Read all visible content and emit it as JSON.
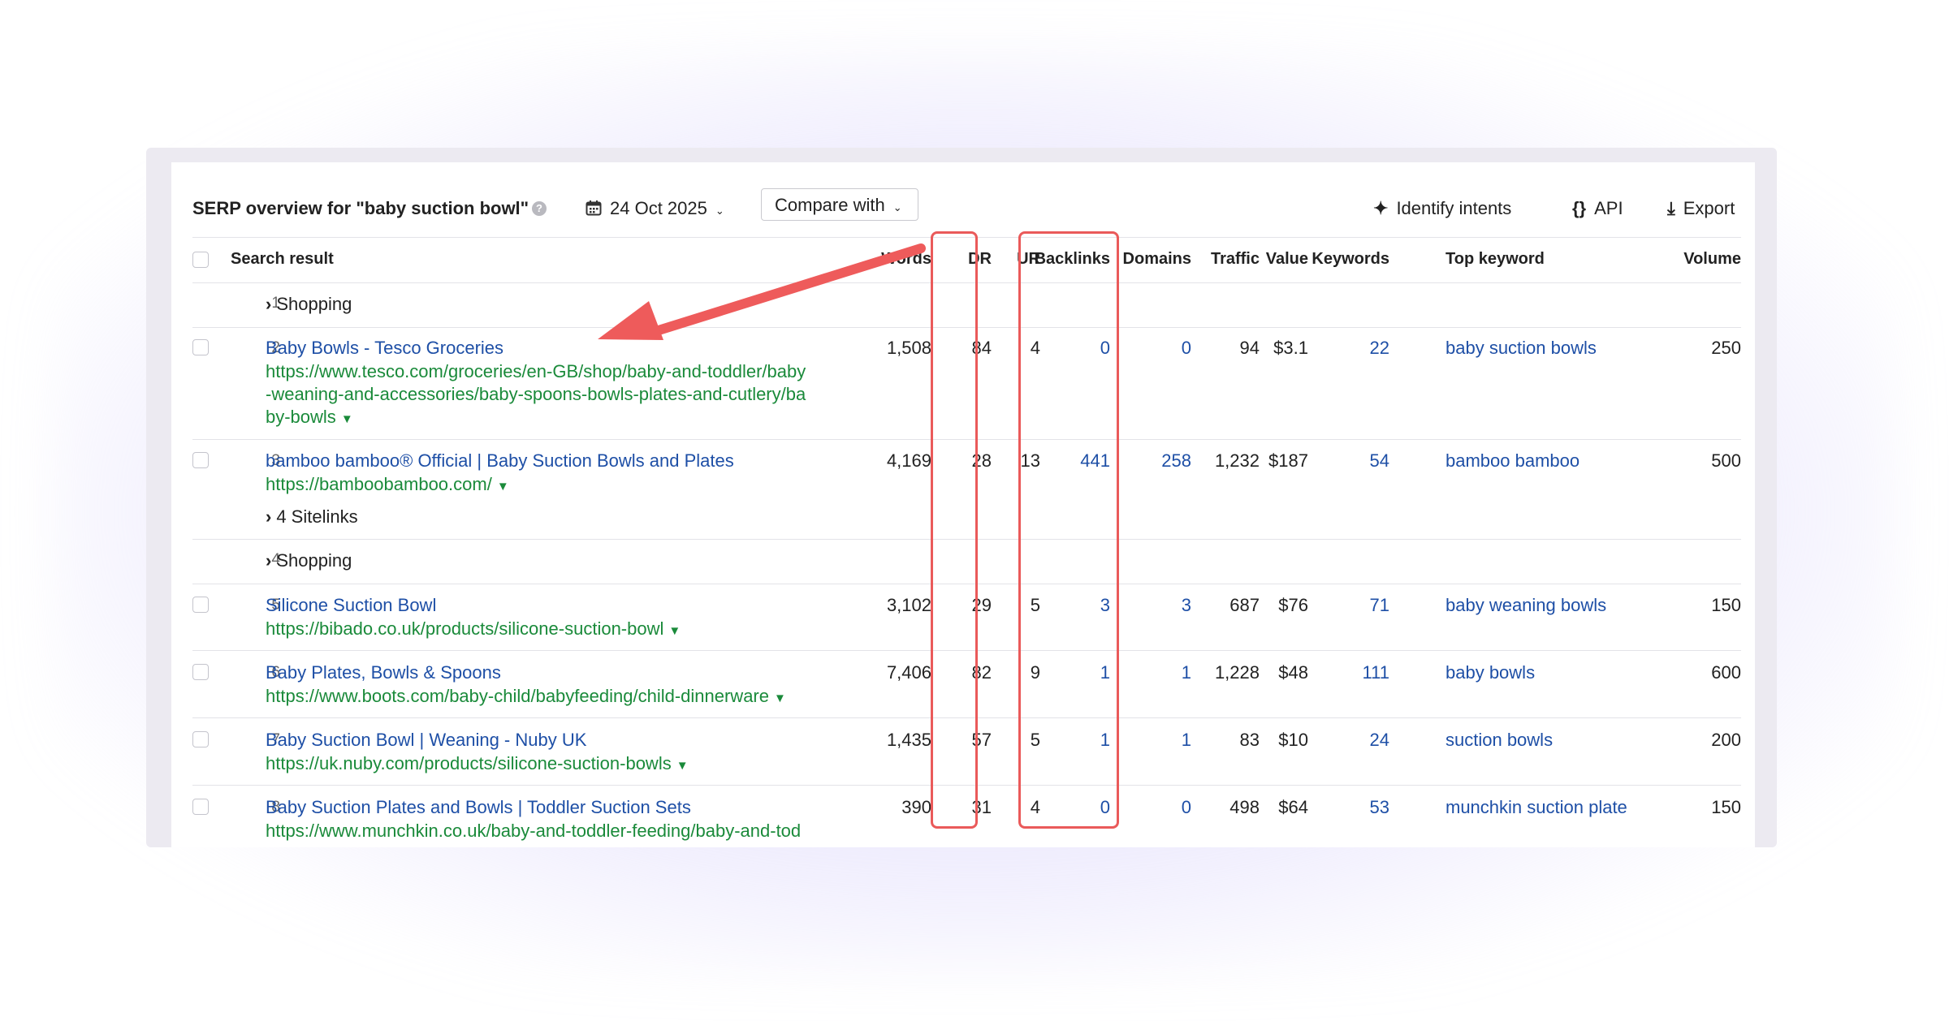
{
  "header": {
    "title": "SERP overview for \"baby suction bowl\"",
    "date": "24 Oct 2025",
    "compare_label": "Compare with",
    "identify_label": "Identify intents",
    "api_label": "API",
    "export_label": "Export"
  },
  "columns": {
    "search_result": "Search result",
    "words": "Words",
    "dr": "DR",
    "ur": "UR",
    "backlinks": "Backlinks",
    "domains": "Domains",
    "traffic": "Traffic",
    "value": "Value",
    "keywords": "Keywords",
    "top_keyword": "Top keyword",
    "volume": "Volume"
  },
  "rows": [
    {
      "n": "1",
      "group": "Shopping"
    },
    {
      "n": "2",
      "title": "Baby Bowls - Tesco Groceries",
      "url_lines": [
        "https://www.tesco.com/groceries/en-GB/shop/baby-and-toddler/baby",
        "-weaning-and-accessories/baby-spoons-bowls-plates-and-cutlery/ba",
        "by-bowls"
      ],
      "words": "1,508",
      "dr": "84",
      "ur": "4",
      "backlinks": "0",
      "domains": "0",
      "traffic": "94",
      "value": "$3.1",
      "keywords": "22",
      "top_keyword": "baby suction bowls",
      "volume": "250"
    },
    {
      "n": "3",
      "title": "bamboo bamboo® Official | Baby Suction Bowls and Plates",
      "url_lines": [
        "https://bamboobamboo.com/"
      ],
      "sitelinks": "4 Sitelinks",
      "words": "4,169",
      "dr": "28",
      "ur": "13",
      "backlinks": "441",
      "domains": "258",
      "traffic": "1,232",
      "value": "$187",
      "keywords": "54",
      "top_keyword": "bamboo bamboo",
      "volume": "500"
    },
    {
      "n": "4",
      "group": "Shopping"
    },
    {
      "n": "5",
      "title": "Silicone Suction Bowl",
      "url_lines": [
        "https://bibado.co.uk/products/silicone-suction-bowl"
      ],
      "words": "3,102",
      "dr": "29",
      "ur": "5",
      "backlinks": "3",
      "domains": "3",
      "traffic": "687",
      "value": "$76",
      "keywords": "71",
      "top_keyword": "baby weaning bowls",
      "volume": "150"
    },
    {
      "n": "6",
      "title": "Baby Plates, Bowls & Spoons",
      "url_lines": [
        "https://www.boots.com/baby-child/babyfeeding/child-dinnerware"
      ],
      "words": "7,406",
      "dr": "82",
      "ur": "9",
      "backlinks": "1",
      "domains": "1",
      "traffic": "1,228",
      "value": "$48",
      "keywords": "111",
      "top_keyword": "baby bowls",
      "volume": "600"
    },
    {
      "n": "7",
      "title": "Baby Suction Bowl | Weaning - Nuby UK",
      "url_lines": [
        "https://uk.nuby.com/products/silicone-suction-bowls"
      ],
      "words": "1,435",
      "dr": "57",
      "ur": "5",
      "backlinks": "1",
      "domains": "1",
      "traffic": "83",
      "value": "$10",
      "keywords": "24",
      "top_keyword": "suction bowls",
      "volume": "200"
    },
    {
      "n": "8",
      "title": "Baby Suction Plates and Bowls | Toddler Suction Sets",
      "url_lines": [
        "https://www.munchkin.co.uk/baby-and-toddler-feeding/baby-and-tod"
      ],
      "words": "390",
      "dr": "31",
      "ur": "4",
      "backlinks": "0",
      "domains": "0",
      "traffic": "498",
      "value": "$64",
      "keywords": "53",
      "top_keyword": "munchkin suction plate",
      "volume": "150"
    }
  ],
  "colors": {
    "link": "#1e4fa6",
    "url": "#1a8a3a",
    "highlight": "#ea5a5a",
    "arrow": "#ee5b5b"
  },
  "icons": [
    "help-icon",
    "calendar-icon",
    "chevron-down-icon",
    "sparkle-icon",
    "braces-icon",
    "download-icon",
    "chevron-right-icon",
    "arrow-annotation"
  ]
}
